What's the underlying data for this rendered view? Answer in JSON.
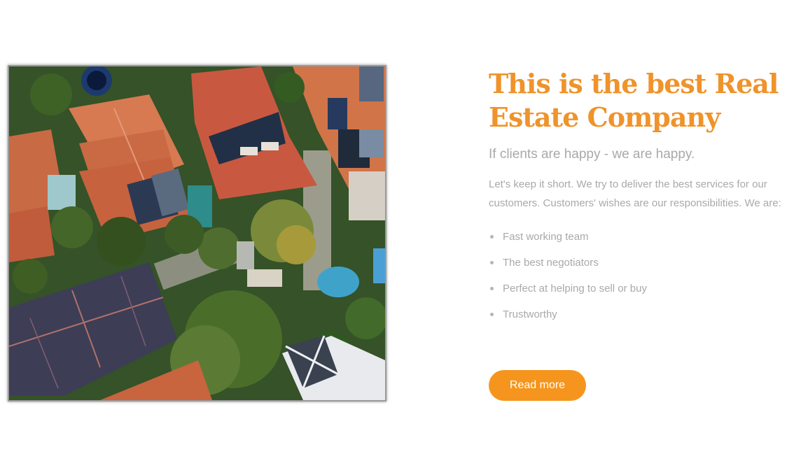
{
  "hero": {
    "title": "This is the best Real Estate Company",
    "subtitle": "If clients are happy - we are happy.",
    "intro": "Let's keep it short. We try to deliver the best services for our customers. Customers' wishes are our responsibilities. We are:",
    "features": [
      "Fast working team",
      "The best negotiators",
      "Perfect at helping to sell or buy",
      "Trustworthy"
    ],
    "read_more_label": "Read more",
    "image_subject": "aerial view of suburban houses with orange tiled roofs and solar panels"
  },
  "colors": {
    "accent": "#f6951d",
    "title": "#ef932b",
    "muted_text": "#a9a9a9",
    "background": "#ffffff"
  }
}
